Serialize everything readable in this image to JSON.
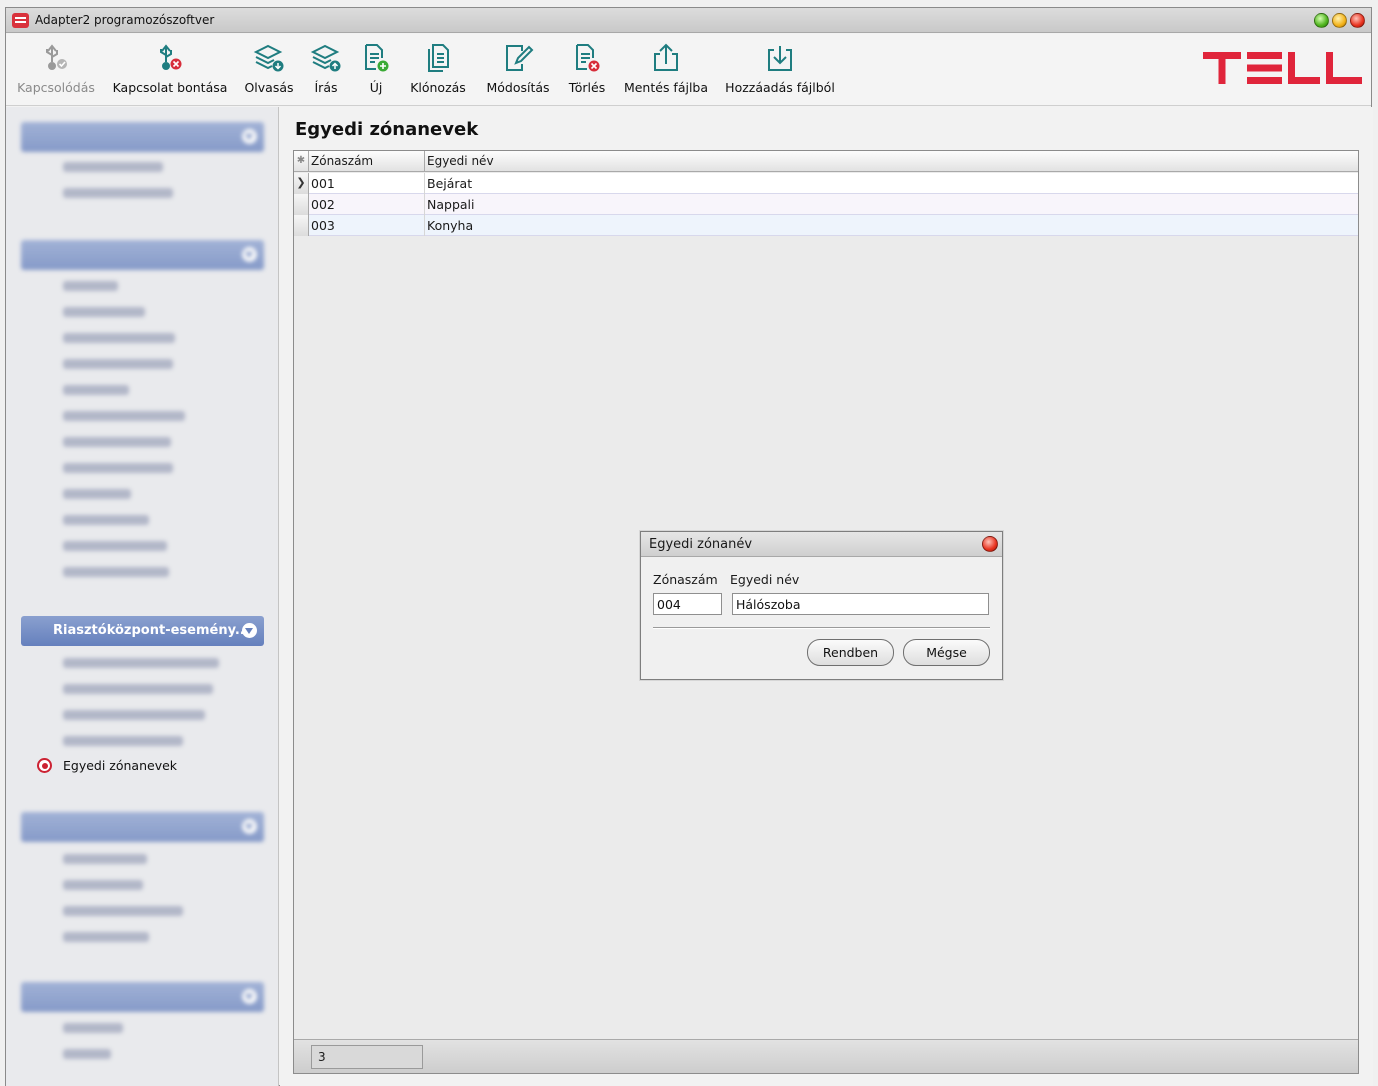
{
  "window": {
    "title": "Adapter2 programozószoftver"
  },
  "toolbar": {
    "buttons": [
      {
        "label": "Kapcsolódás",
        "icon": "usb-connect-icon",
        "enabled": false
      },
      {
        "label": "Kapcsolat bontása",
        "icon": "usb-disconnect-icon",
        "enabled": true
      },
      {
        "label": "Olvasás",
        "icon": "read-layers-icon",
        "enabled": true
      },
      {
        "label": "Írás",
        "icon": "write-layers-icon",
        "enabled": true
      },
      {
        "label": "Új",
        "icon": "new-document-icon",
        "enabled": true
      },
      {
        "label": "Klónozás",
        "icon": "clone-documents-icon",
        "enabled": true
      },
      {
        "label": "Módosítás",
        "icon": "edit-document-icon",
        "enabled": true
      },
      {
        "label": "Törlés",
        "icon": "delete-document-icon",
        "enabled": true
      },
      {
        "label": "Mentés fájlba",
        "icon": "export-file-icon",
        "enabled": true
      },
      {
        "label": "Hozzáadás fájlból",
        "icon": "import-file-icon",
        "enabled": true
      }
    ],
    "logo_text": "TELL",
    "logo_color": "#e0253b"
  },
  "sidebar": {
    "visible_group": "Riasztóközpont-esemény...",
    "active_item": "Egyedi zónanevek"
  },
  "main": {
    "title": "Egyedi zónanevek",
    "columns": [
      "Zónaszám",
      "Egyedi név"
    ],
    "rows": [
      {
        "zone": "001",
        "name": "Bejárat"
      },
      {
        "zone": "002",
        "name": "Nappali"
      },
      {
        "zone": "003",
        "name": "Konyha"
      }
    ],
    "row_count": "3"
  },
  "dialog": {
    "title": "Egyedi zónanév",
    "zone_label": "Zónaszám",
    "name_label": "Egyedi név",
    "zone_value": "004",
    "name_value": "Hálószoba",
    "ok_label": "Rendben",
    "cancel_label": "Mégse"
  },
  "colors": {
    "sidebar_header": "#6f89c4",
    "accent_red": "#cc2233"
  }
}
